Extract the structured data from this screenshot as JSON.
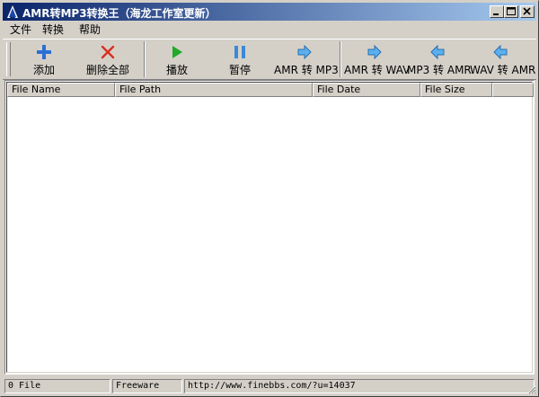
{
  "window": {
    "title": "AMR转MP3转换王（海龙工作室更新）"
  },
  "menu": {
    "items": [
      "文件",
      "转换",
      "帮助"
    ]
  },
  "toolbar": {
    "buttons": [
      {
        "label": "添加",
        "icon": "plus-icon"
      },
      {
        "label": "删除全部",
        "icon": "delete-x-icon"
      },
      {
        "label": "播放",
        "icon": "play-icon"
      },
      {
        "label": "暂停",
        "icon": "pause-icon"
      },
      {
        "label": "AMR 转 MP3",
        "icon": "arrow-right-icon"
      },
      {
        "label": "AMR 转 WAV",
        "icon": "arrow-right-icon"
      },
      {
        "label": "MP3 转 AMR",
        "icon": "arrow-left-icon"
      },
      {
        "label": "WAV 转 AMR",
        "icon": "arrow-left-icon"
      }
    ]
  },
  "list": {
    "columns": [
      "File Name",
      "File Path",
      "File Date",
      "File Size"
    ],
    "rows": []
  },
  "status": {
    "file_count": "0 File",
    "license": "Freeware",
    "url": "http://www.finebbs.com/?u=14037"
  },
  "colors": {
    "title_start": "#0a246a",
    "title_end": "#a6caf0",
    "face": "#d4d0c8",
    "add_icon": "#2a6fd6",
    "delete_icon": "#d83020",
    "play_icon": "#22a82a",
    "pause_icon": "#3a8ad8",
    "arrow_icon": "#5ab0ee"
  }
}
